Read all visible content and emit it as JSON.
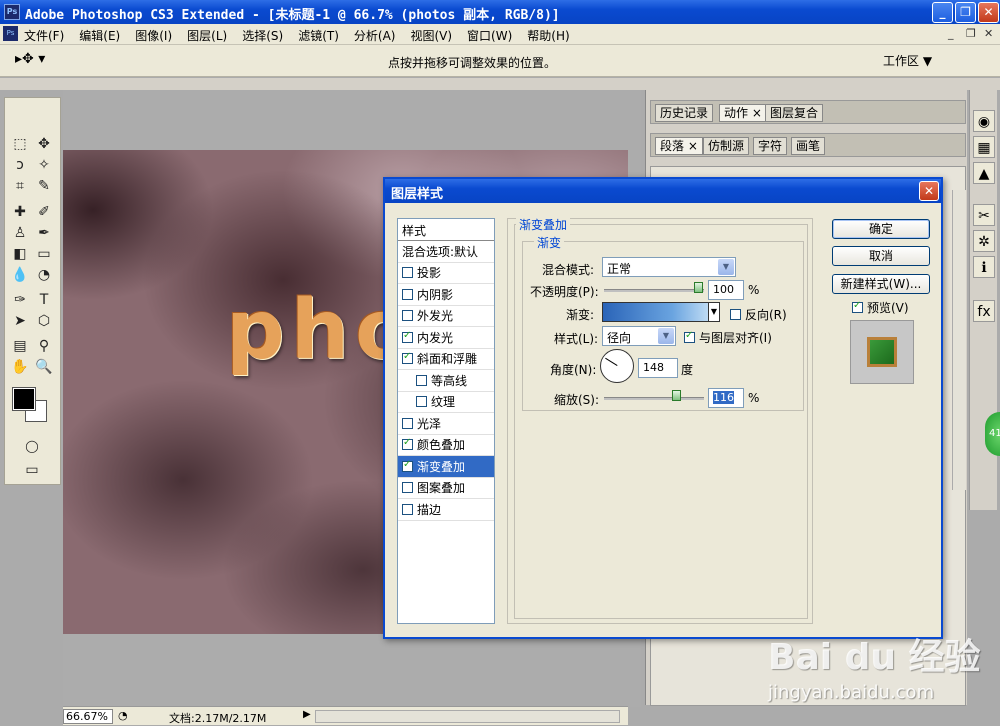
{
  "window": {
    "app_badge": "Ps",
    "title": "Adobe Photoshop CS3 Extended - [未标题-1 @ 66.7% (photos 副本, RGB/8)]",
    "btn_min": "_",
    "btn_max": "❐",
    "btn_close": "✕"
  },
  "menubar": {
    "items": [
      "文件(F)",
      "编辑(E)",
      "图像(I)",
      "图层(L)",
      "选择(S)",
      "滤镜(T)",
      "分析(A)",
      "视图(V)",
      "窗口(W)",
      "帮助(H)"
    ],
    "mdi_min": "_",
    "mdi_max": "❐",
    "mdi_close": "✕"
  },
  "options_bar": {
    "hint": "点按并拖移可调整效果的位置。",
    "workspace": "工作区 ▼"
  },
  "canvas": {
    "art_text": "pho",
    "zoom": "66.67%",
    "doc_info": "文档:2.17M/2.17M"
  },
  "panels": {
    "group1": [
      "历史记录",
      "动作 ×",
      "图层复合"
    ],
    "group2": [
      "段落 ×",
      "仿制源",
      "字符",
      "画笔"
    ]
  },
  "badge": "41",
  "dialog": {
    "title": "图层样式",
    "close": "✕",
    "list_header": "样式",
    "blend_options": "混合选项:默认",
    "styles": [
      {
        "label": "投影",
        "checked": false,
        "indent": false
      },
      {
        "label": "内阴影",
        "checked": false,
        "indent": false
      },
      {
        "label": "外发光",
        "checked": false,
        "indent": false
      },
      {
        "label": "内发光",
        "checked": true,
        "indent": false
      },
      {
        "label": "斜面和浮雕",
        "checked": true,
        "indent": false
      },
      {
        "label": "等高线",
        "checked": false,
        "indent": true
      },
      {
        "label": "纹理",
        "checked": false,
        "indent": true
      },
      {
        "label": "光泽",
        "checked": false,
        "indent": false
      },
      {
        "label": "颜色叠加",
        "checked": true,
        "indent": false
      },
      {
        "label": "渐变叠加",
        "checked": true,
        "indent": false,
        "selected": true
      },
      {
        "label": "图案叠加",
        "checked": false,
        "indent": false
      },
      {
        "label": "描边",
        "checked": false,
        "indent": false
      }
    ],
    "section_title": "渐变叠加",
    "group_title": "渐变",
    "blend_mode_label": "混合模式:",
    "blend_mode_value": "正常",
    "opacity_label": "不透明度(P):",
    "opacity_value": "100",
    "opacity_level": 100,
    "percent": "%",
    "gradient_label": "渐变:",
    "reverse_label": "反向(R)",
    "reverse_checked": false,
    "style_label": "样式(L):",
    "style_value": "径向",
    "align_label": "与图层对齐(I)",
    "align_checked": true,
    "angle_label": "角度(N):",
    "angle_value": "148",
    "angle_unit": "度",
    "scale_label": "缩放(S):",
    "scale_value": "116",
    "buttons": {
      "ok": "确定",
      "cancel": "取消",
      "new_style": "新建样式(W)...",
      "preview": "预览(V)"
    },
    "preview_checked": true
  },
  "watermark": {
    "brand": "Bai du 经验",
    "url": "jingyan.baidu.com"
  }
}
